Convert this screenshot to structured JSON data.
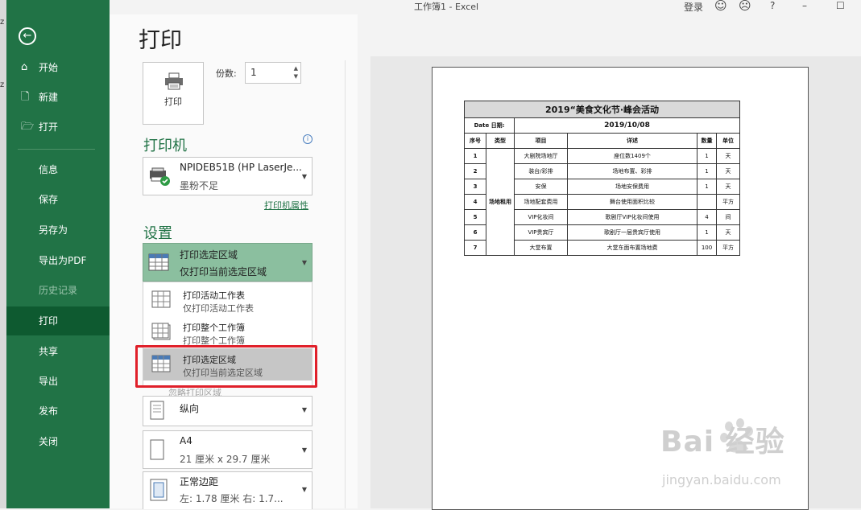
{
  "title_bar": {
    "title": "工作簿1  -  Excel",
    "login": "登录",
    "smile": "☺",
    "frown": "☹",
    "help": "?",
    "minimize": "–",
    "maximize": "☐"
  },
  "edge_chars": [
    "z",
    "z"
  ],
  "sidebar": {
    "back": "←",
    "items": [
      {
        "label": "开始",
        "icon": "⌂"
      },
      {
        "label": "新建",
        "icon": "🗋"
      },
      {
        "label": "打开",
        "icon": "🗁"
      },
      {
        "label": "信息"
      },
      {
        "label": "保存"
      },
      {
        "label": "另存为"
      },
      {
        "label": "导出为PDF"
      },
      {
        "label": "历史记录"
      },
      {
        "label": "打印"
      },
      {
        "label": "共享"
      },
      {
        "label": "导出"
      },
      {
        "label": "发布"
      },
      {
        "label": "关闭"
      }
    ]
  },
  "print": {
    "heading": "打印",
    "print_button": "打印",
    "copies_label": "份数:",
    "copies_value": "1",
    "printer_heading": "打印机",
    "printer_name": "NPIDEB51B (HP LaserJe...",
    "printer_status": "墨粉不足",
    "printer_props": "打印机属性",
    "settings_heading": "设置",
    "selected_option": {
      "title": "打印选定区域",
      "desc": "仅打印当前选定区域"
    },
    "menu": [
      {
        "title": "打印活动工作表",
        "desc": "仅打印活动工作表"
      },
      {
        "title": "打印整个工作簿",
        "desc": "打印整个工作簿"
      },
      {
        "title": "打印选定区域",
        "desc": "仅打印当前选定区域"
      }
    ],
    "ignore_area": "忽略打印区域",
    "orientation": "纵向",
    "paper_size": "A4",
    "paper_dims": "21 厘米 x 29.7 厘米",
    "margins": "正常边距",
    "margins_detail": "左: 1.78 厘米    右: 1.7..."
  },
  "sheet": {
    "title": "2019“美食文化节·峰会活动",
    "date_label": "Date  日期:",
    "date_value": "2019/10/08",
    "headers": [
      "序号",
      "类型",
      "项目",
      "详述",
      "数量",
      "单位"
    ],
    "merged_type": "场地租用",
    "rows": [
      {
        "no": "1",
        "item": "大剧院场地厅",
        "detail": "座位数1409个",
        "qty": "1",
        "unit": "天"
      },
      {
        "no": "2",
        "item": "装台/彩排",
        "detail": "场地布置、彩排",
        "qty": "1",
        "unit": "天"
      },
      {
        "no": "3",
        "item": "安保",
        "detail": "场地安保费用",
        "qty": "1",
        "unit": "天"
      },
      {
        "no": "4",
        "item": "场地配套费用",
        "detail": "舞台使用面积比较",
        "qty": "",
        "unit": "平方"
      },
      {
        "no": "5",
        "item": "VIP化妆间",
        "detail": "歌剧厅VIP化妆间使用",
        "qty": "4",
        "unit": "间"
      },
      {
        "no": "6",
        "item": "VIP贵宾厅",
        "detail": "歌剧厅一层贵宾厅使用",
        "qty": "1",
        "unit": "天"
      },
      {
        "no": "7",
        "item": "大堂布置",
        "detail": "大堂东面布置场地费",
        "qty": "100",
        "unit": "平方"
      }
    ]
  },
  "watermark": {
    "brand": "Bai  经验",
    "url": "jingyan.baidu.com"
  }
}
